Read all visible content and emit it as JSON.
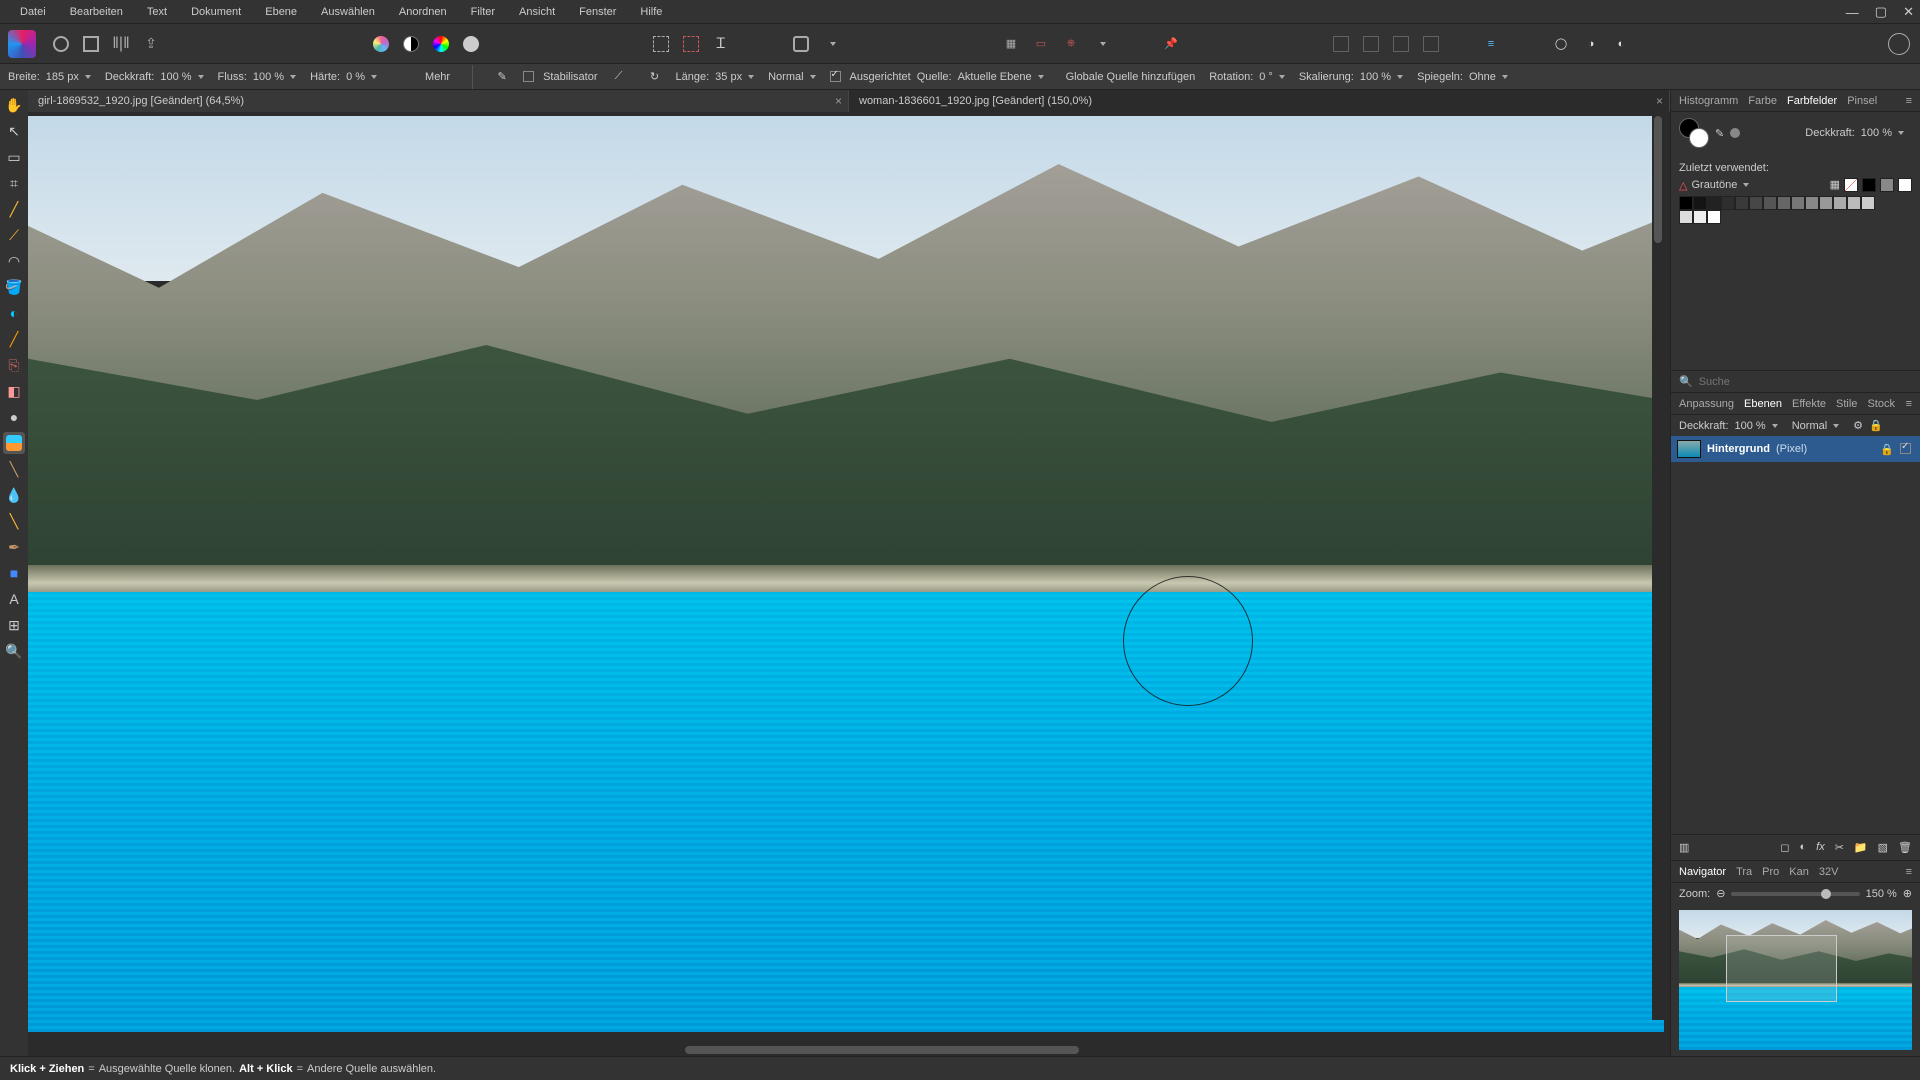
{
  "menu": {
    "items": [
      "Datei",
      "Bearbeiten",
      "Text",
      "Dokument",
      "Ebene",
      "Auswählen",
      "Anordnen",
      "Filter",
      "Ansicht",
      "Fenster",
      "Hilfe"
    ]
  },
  "doctabs": [
    {
      "label": "girl-1869532_1920.jpg [Geändert] (64,5%)",
      "active": true
    },
    {
      "label": "woman-1836601_1920.jpg [Geändert] (150,0%)",
      "active": false
    }
  ],
  "context": {
    "width_label": "Breite:",
    "width_value": "185 px",
    "opacity_label": "Deckkraft:",
    "opacity_value": "100 %",
    "flow_label": "Fluss:",
    "flow_value": "100 %",
    "hardness_label": "Härte:",
    "hardness_value": "0 %",
    "more_label": "Mehr",
    "stabiliser_label": "Stabilisator",
    "length_label": "Länge:",
    "length_value": "35 px",
    "mode_value": "Normal",
    "aligned_label": "Ausgerichtet",
    "source_label": "Quelle:",
    "source_value": "Aktuelle Ebene",
    "global_source_label": "Globale Quelle hinzufügen",
    "rotation_label": "Rotation:",
    "rotation_value": "0 °",
    "scale_label": "Skalierung:",
    "scale_value": "100 %",
    "mirror_label": "Spiegeln:",
    "mirror_value": "Ohne"
  },
  "right_tabs_top": {
    "items": [
      "Histogramm",
      "Farbe",
      "Farbfelder",
      "Pinsel"
    ],
    "active": 2
  },
  "swatches": {
    "opacity_label": "Deckkraft:",
    "opacity_value": "100 %",
    "recent_label": "Zuletzt verwendet:",
    "preset_label": "Grautöne",
    "search_placeholder": "Suche"
  },
  "right_tabs_mid": {
    "items": [
      "Anpassung",
      "Ebenen",
      "Effekte",
      "Stile",
      "Stock"
    ],
    "active": 1
  },
  "layers": {
    "opacity_label": "Deckkraft:",
    "opacity_value": "100 %",
    "blend_value": "Normal",
    "items": [
      {
        "name": "Hintergrund",
        "type": "(Pixel)"
      }
    ]
  },
  "right_tabs_bot": {
    "items": [
      "Navigator",
      "Tra",
      "Pro",
      "Kan",
      "32V"
    ],
    "active": 0
  },
  "navigator": {
    "zoom_label": "Zoom:",
    "zoom_value": "150 %"
  },
  "status": {
    "klick_ziehen": "Klick + Ziehen",
    "eq1": " = ",
    "text1": "Ausgewählte Quelle klonen. ",
    "alt_klick": "Alt + Klick",
    "eq2": " = ",
    "text2": "Andere Quelle auswählen."
  },
  "tools": [
    "hand",
    "move",
    "crop",
    "brush",
    "dropper",
    "lasso",
    "flood",
    "heal",
    "clone",
    "eraser",
    "sponge",
    "dodge",
    "pen",
    "persona",
    "shape",
    "text",
    "mesh",
    "zoom"
  ]
}
